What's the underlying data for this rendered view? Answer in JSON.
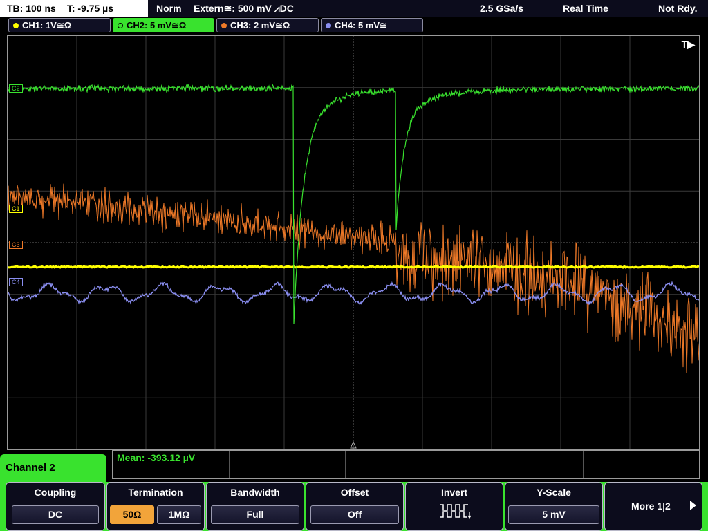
{
  "topbar": {
    "timebase": "TB: 100 ns",
    "trigger_time": "T: -9.75 µs",
    "mode": "Norm",
    "trigger_source": "Extern≅: 500 mV ⩘DC",
    "sample_rate": "2.5 GSa/s",
    "acq_mode": "Real Time",
    "status": "Not Rdy."
  },
  "channels": [
    {
      "label": "CH1: 1V≅Ω",
      "color": "#ffff00",
      "active": false
    },
    {
      "label": "CH2: 5 mV≅Ω",
      "color": "#39e22e",
      "active": true
    },
    {
      "label": "CH3: 2 mV≅Ω",
      "color": "#f07a28",
      "active": false
    },
    {
      "label": "CH4: 5 mV≅",
      "color": "#8a8ef0",
      "active": false
    }
  ],
  "grid": {
    "trigger_marker": "T▶",
    "markers": [
      {
        "label": "C2",
        "color": "#39e22e"
      },
      {
        "label": "C1",
        "color": "#ffff00"
      },
      {
        "label": "C3",
        "color": "#f07a28"
      },
      {
        "label": "C4",
        "color": "#8a8ef0"
      }
    ]
  },
  "waveform_colors": {
    "ch1": "#ffff00",
    "ch2": "#39e22e",
    "ch3": "#f07a28",
    "ch4": "#8a8ef0"
  },
  "menu": {
    "title": "Channel 2",
    "measurement": "Mean: -393.12 µV",
    "softkeys": {
      "coupling": {
        "title": "Coupling",
        "value": "DC"
      },
      "termination": {
        "title": "Termination",
        "option_a": "50Ω",
        "option_b": "1MΩ",
        "selected": "50Ω"
      },
      "bandwidth": {
        "title": "Bandwidth",
        "value": "Full"
      },
      "offset": {
        "title": "Offset",
        "value": "Off"
      },
      "invert": {
        "title": "Invert",
        "icon": "invert-waveform-icon"
      },
      "yscale": {
        "title": "Y-Scale",
        "value": "5 mV"
      },
      "more": {
        "label": "More 1|2"
      }
    }
  }
}
